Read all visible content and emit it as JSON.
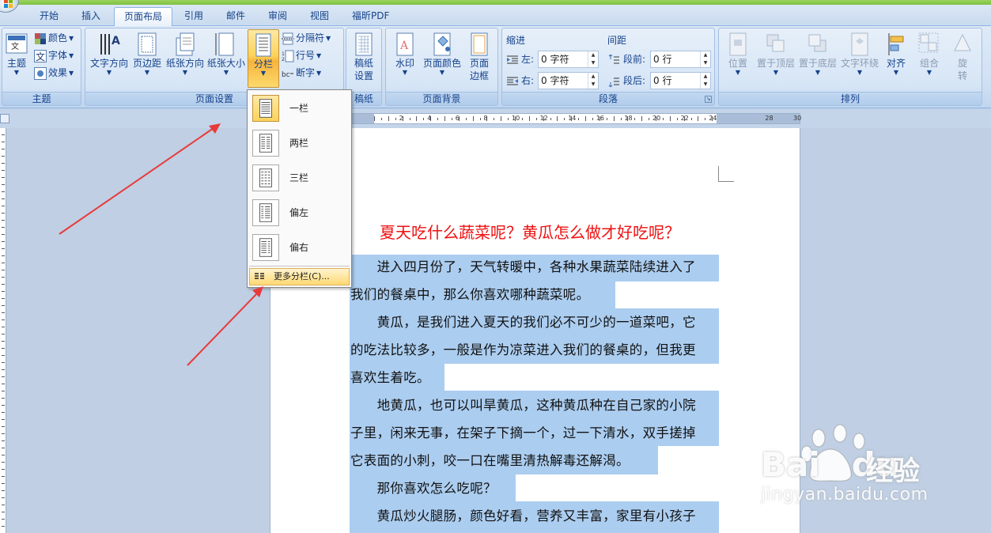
{
  "tabs": [
    "开始",
    "插入",
    "页面布局",
    "引用",
    "邮件",
    "审阅",
    "视图",
    "福昕PDF"
  ],
  "active_tab": "页面布局",
  "ribbon": {
    "theme": {
      "label": "主题",
      "big": "主题",
      "small": [
        "颜色",
        "字体",
        "效果"
      ]
    },
    "page_setup": {
      "label": "页面设置",
      "text_direction": "文字方向",
      "margins": "页边距",
      "orientation": "纸张方向",
      "size": "纸张大小",
      "columns": "分栏",
      "breaks": "分隔符",
      "line_numbers": "行号",
      "hyphenation": "断字"
    },
    "manuscript": {
      "label": "稿纸",
      "big": [
        "稿纸",
        "设置"
      ]
    },
    "page_background": {
      "label": "页面背景",
      "watermark": "水印",
      "page_color": "页面颜色",
      "page_borders": [
        "页面",
        "边框"
      ]
    },
    "paragraph": {
      "label": "段落",
      "indent_head": "缩进",
      "spacing_head": "间距",
      "left_label": "左:",
      "left_value": "0 字符",
      "right_label": "右:",
      "right_value": "0 字符",
      "before_label": "段前:",
      "before_value": "0 行",
      "after_label": "段后:",
      "after_value": "0 行"
    },
    "arrange": {
      "label": "排列",
      "position": "位置",
      "bring_front": "置于顶层",
      "send_back": "置于底层",
      "text_wrap": "文字环绕",
      "align": "对齐",
      "group": "组合",
      "rotate": [
        "旋",
        "转"
      ]
    }
  },
  "columns_menu": {
    "items": [
      "一栏",
      "两栏",
      "三栏",
      "偏左",
      "偏右"
    ],
    "selected": "一栏",
    "more": "更多分栏(C)..."
  },
  "document": {
    "title": "夏天吃什么蔬菜呢？黄瓜怎么做才好吃呢？",
    "lines": [
      "　　进入四月份了，天气转暖中，各种水果蔬菜陆续进入了",
      "我们的餐桌中，那么你喜欢哪种蔬菜呢。",
      "　　黄瓜，是我们进入夏天的我们必不可少的一道菜吧，它",
      "的吃法比较多，一般是作为凉菜进入我们的餐桌的，但我更",
      "喜欢生着吃。",
      "　　地黄瓜，也可以叫旱黄瓜，这种黄瓜种在自己家的小院",
      "子里，闲来无事，在架子下摘一个，过一下清水，双手搓掉",
      "它表面的小刺，咬一口在嘴里清热解毒还解渴。",
      "　　那你喜欢怎么吃呢？",
      "　　黄瓜炒火腿肠，颜色好看，营养又丰富，家里有小孩子"
    ]
  },
  "ruler": {
    "numbers": [
      "2",
      "4",
      "6",
      "8",
      "10",
      "12",
      "14",
      "16",
      "18",
      "20",
      "22",
      "24",
      "28",
      "30"
    ]
  },
  "watermark": {
    "brand": "Bai",
    "brand2": "du",
    "cn": "经验",
    "url": "jingyan.baidu.com"
  },
  "colors": {
    "title_red": "#ee1111",
    "selection": "#abcdf0",
    "arrow_red": "#e83a3a"
  }
}
